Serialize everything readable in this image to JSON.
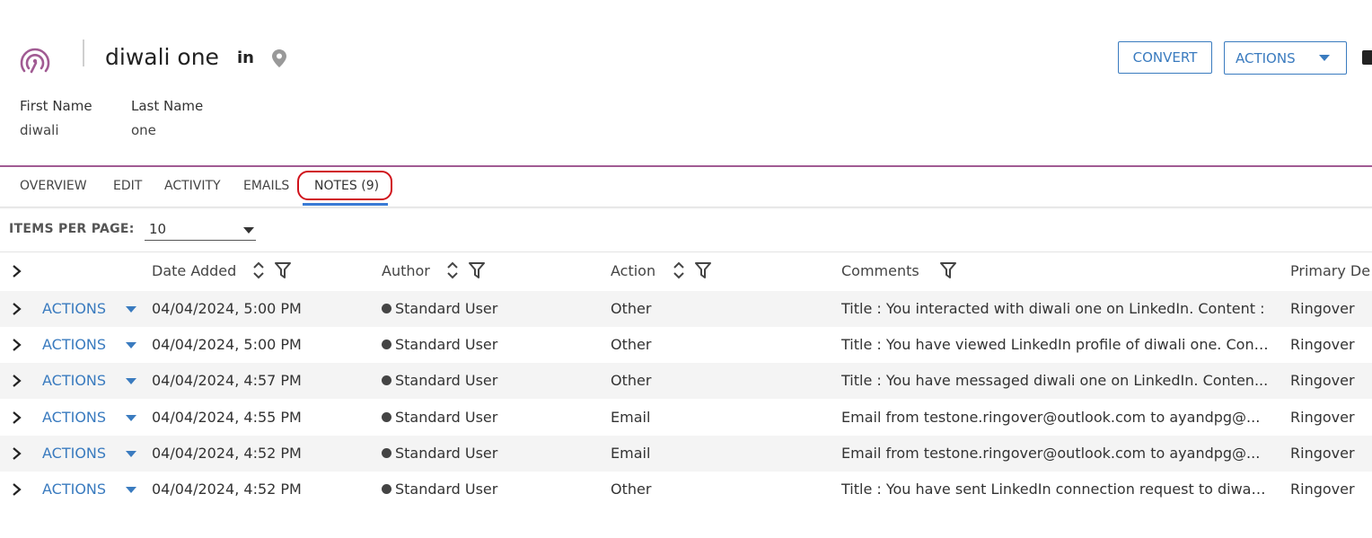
{
  "header": {
    "title": "diwali one",
    "linkedin_icon_text": "in",
    "icons": {
      "logo": "ringover-signal-logo-icon",
      "linkedin": "linkedin-icon",
      "location": "map-pin-icon",
      "print": "printer-icon"
    },
    "convert_label": "CONVERT",
    "actions_label": "ACTIONS"
  },
  "fields": [
    {
      "label": "First Name",
      "value": "diwali"
    },
    {
      "label": "Last Name",
      "value": "one"
    }
  ],
  "tabs": [
    "OVERVIEW",
    "EDIT",
    "ACTIVITY",
    "EMAILS",
    "NOTES (9)"
  ],
  "active_tab": "NOTES (9)",
  "pagination": {
    "label": "ITEMS PER PAGE:",
    "value": "10"
  },
  "table": {
    "columns": [
      "Date Added",
      "Author",
      "Action",
      "Comments",
      "Primary De"
    ],
    "row_action_label": "ACTIONS",
    "rows": [
      {
        "date": "04/04/2024, 5:00 PM",
        "author": "Standard User",
        "action": "Other",
        "comment": "Title : You interacted with diwali one on LinkedIn. Content :",
        "primary": "Ringover"
      },
      {
        "date": "04/04/2024, 5:00 PM",
        "author": "Standard User",
        "action": "Other",
        "comment": "Title : You have viewed LinkedIn profile of diwali one. Cont...",
        "primary": "Ringover"
      },
      {
        "date": "04/04/2024, 4:57 PM",
        "author": "Standard User",
        "action": "Other",
        "comment": "Title : You have messaged diwali one on LinkedIn. Conten...",
        "primary": "Ringover"
      },
      {
        "date": "04/04/2024, 4:55 PM",
        "author": "Standard User",
        "action": "Email",
        "comment": "Email from testone.ringover@outlook.com to ayandpg@...",
        "primary": "Ringover"
      },
      {
        "date": "04/04/2024, 4:52 PM",
        "author": "Standard User",
        "action": "Email",
        "comment": "Email from testone.ringover@outlook.com to ayandpg@...",
        "primary": "Ringover"
      },
      {
        "date": "04/04/2024, 4:52 PM",
        "author": "Standard User",
        "action": "Other",
        "comment": "Title : You have sent LinkedIn connection request to diwal...",
        "primary": "Ringover"
      }
    ]
  },
  "colors": {
    "accent": "#3a7bbf",
    "brand": "#a15b93",
    "highlight": "#d0121b",
    "tab_underline": "#3a7bd5"
  }
}
